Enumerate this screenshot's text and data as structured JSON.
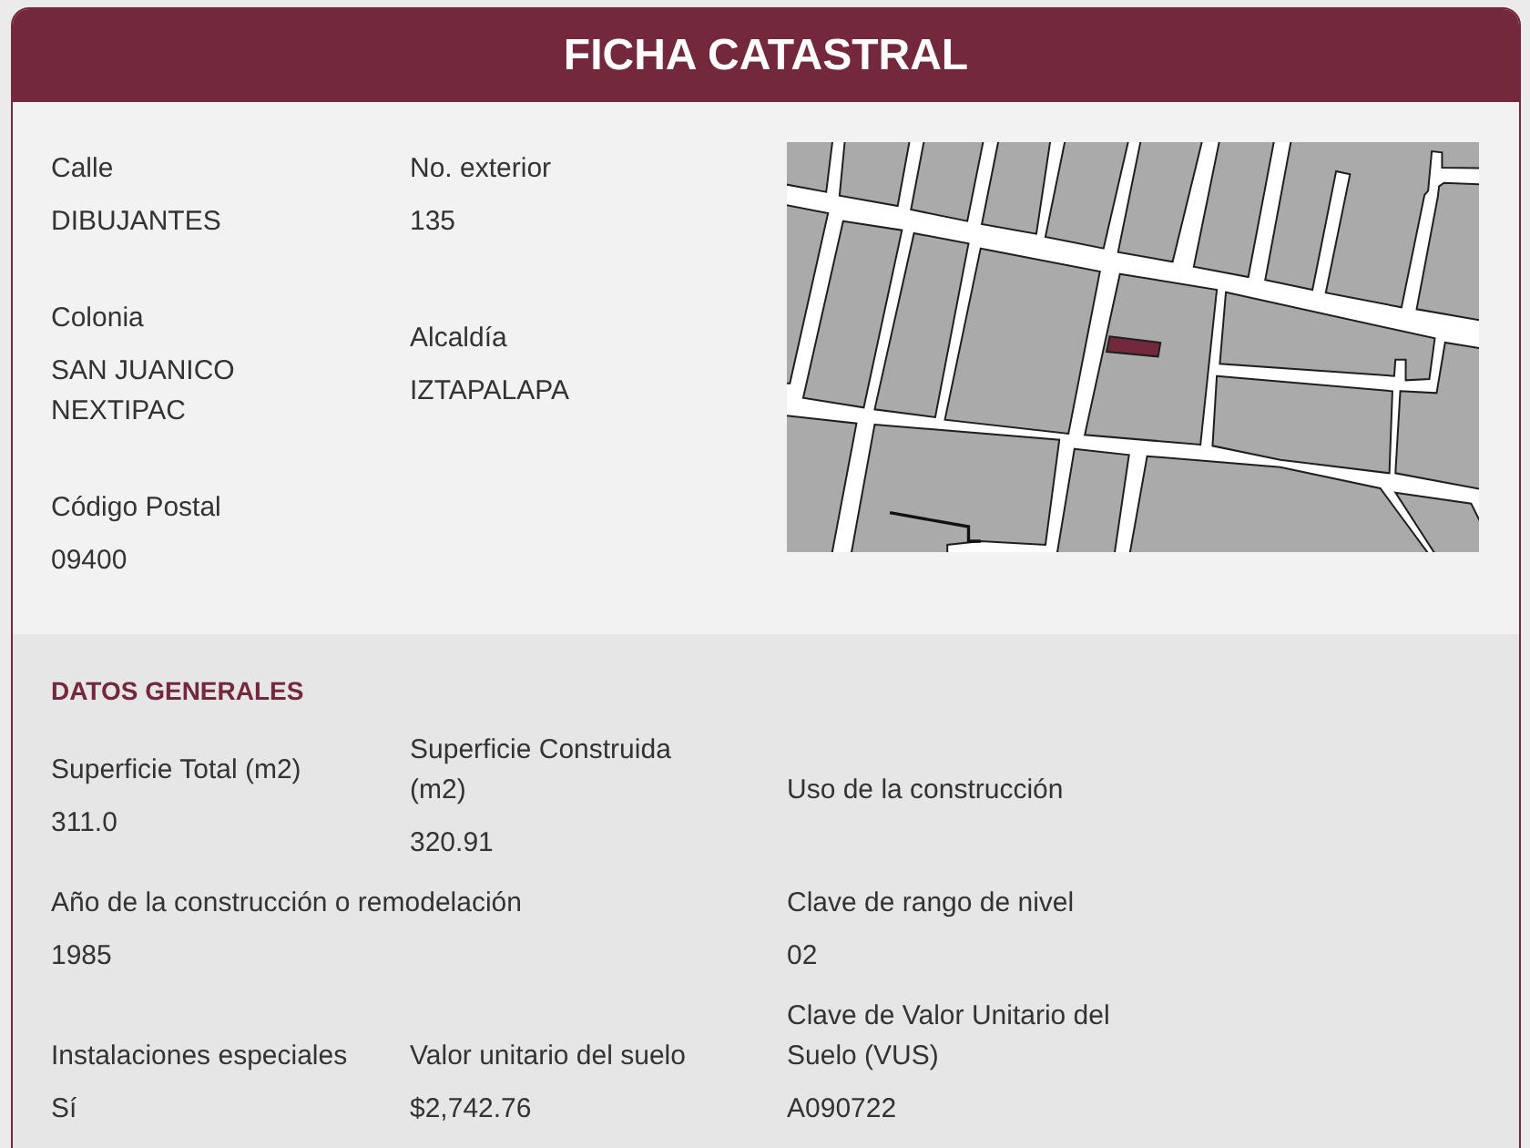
{
  "header": {
    "title": "FICHA CATASTRAL"
  },
  "location": {
    "rows": [
      [
        {
          "label": "Calle",
          "value": "DIBUJANTES"
        },
        {
          "label": "No. exterior",
          "value": "135"
        }
      ],
      [
        {
          "label": "Colonia",
          "value": "SAN JUANICO NEXTIPAC"
        },
        {
          "label": "Alcaldía",
          "value": "IZTAPALAPA"
        }
      ],
      [
        {
          "label": "Código Postal",
          "value": "09400"
        }
      ]
    ]
  },
  "general_data": {
    "heading": "DATOS GENERALES",
    "rows": [
      [
        {
          "label": "Superficie Total (m2)",
          "value": "311.0"
        },
        {
          "label": "Superficie Construida (m2)",
          "value": "320.91"
        },
        {
          "label": "Uso de la construcción"
        }
      ],
      [
        {
          "label": "Año de la construcción o remodelación",
          "value": "1985"
        },
        "",
        {
          "label": "Clave de rango de nivel",
          "value": "02"
        }
      ],
      [
        {
          "label": "Instalaciones especiales",
          "value": "Sí"
        },
        {
          "label": "Valor unitario del suelo",
          "value": "$2,742.76"
        },
        {
          "label": "Clave de Valor Unitario del Suelo (VUS)",
          "value": "A090722"
        }
      ]
    ]
  }
}
